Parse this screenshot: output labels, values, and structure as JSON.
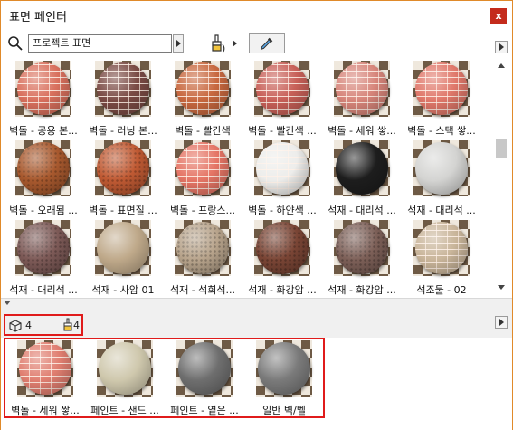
{
  "window": {
    "title": "표면 페인터",
    "close_label": "x"
  },
  "toolbar": {
    "search_icon": "search-icon",
    "search_value": "프로젝트 표면",
    "brush_icon": "paint-brush-icon",
    "eyedropper_icon": "eyedropper-icon"
  },
  "surfaces": [
    {
      "label": "벽돌 - 공용 본...",
      "color": "#d9705d",
      "style": "brick"
    },
    {
      "label": "벽돌 - 러닝 본...",
      "color": "#7a4a44",
      "style": "brick"
    },
    {
      "label": "벽돌 - 빨간색",
      "color": "#c8683f",
      "style": "brick"
    },
    {
      "label": "벽돌 - 빨간색 ...",
      "color": "#c86058",
      "style": "brick"
    },
    {
      "label": "벽돌 - 세워 쌓...",
      "color": "#d7857a",
      "style": "brick"
    },
    {
      "label": "벽돌 - 스택 쌓...",
      "color": "#e0786a",
      "style": "brick"
    },
    {
      "label": "벽돌 - 오래됨 ...",
      "color": "#a8592e",
      "style": "speckle"
    },
    {
      "label": "벽돌 - 표면질 ...",
      "color": "#c05a33",
      "style": "speckle"
    },
    {
      "label": "벽돌 - 프랑스...",
      "color": "#e57565",
      "style": "brick"
    },
    {
      "label": "벽돌 - 하얀색 ...",
      "color": "#ededeb",
      "style": "brick"
    },
    {
      "label": "석재 - 대리석 ...",
      "color": "#1d1d1d",
      "style": "smooth"
    },
    {
      "label": "석재 - 대리석 ...",
      "color": "#d4d4d2",
      "style": "smooth"
    },
    {
      "label": "석재 - 대리석 ...",
      "color": "#7d5a57",
      "style": "speckle"
    },
    {
      "label": "석재 - 사암 01",
      "color": "#bfa98a",
      "style": "smooth"
    },
    {
      "label": "석재 - 석회석...",
      "color": "#b8a48c",
      "style": "speckle"
    },
    {
      "label": "석재 - 화강암 ...",
      "color": "#7a4535",
      "style": "speckle"
    },
    {
      "label": "석재 - 화강암 ...",
      "color": "#7d6058",
      "style": "speckle"
    },
    {
      "label": "석조물 - 02",
      "color": "#c9b59a",
      "style": "brick"
    }
  ],
  "used": {
    "object_count": "4",
    "surface_count": "4",
    "items": [
      {
        "label": "벽돌 - 세워 쌓...",
        "color": "#e07e70",
        "style": "brick"
      },
      {
        "label": "페인트 - 샌드 ...",
        "color": "#cfc8ad",
        "style": "smooth"
      },
      {
        "label": "페인트 - 옅은 ...",
        "color": "#6e6e6e",
        "style": "smooth"
      },
      {
        "label": "일반 벽/벨",
        "color": "#7a7a7a",
        "style": "smooth"
      }
    ]
  }
}
